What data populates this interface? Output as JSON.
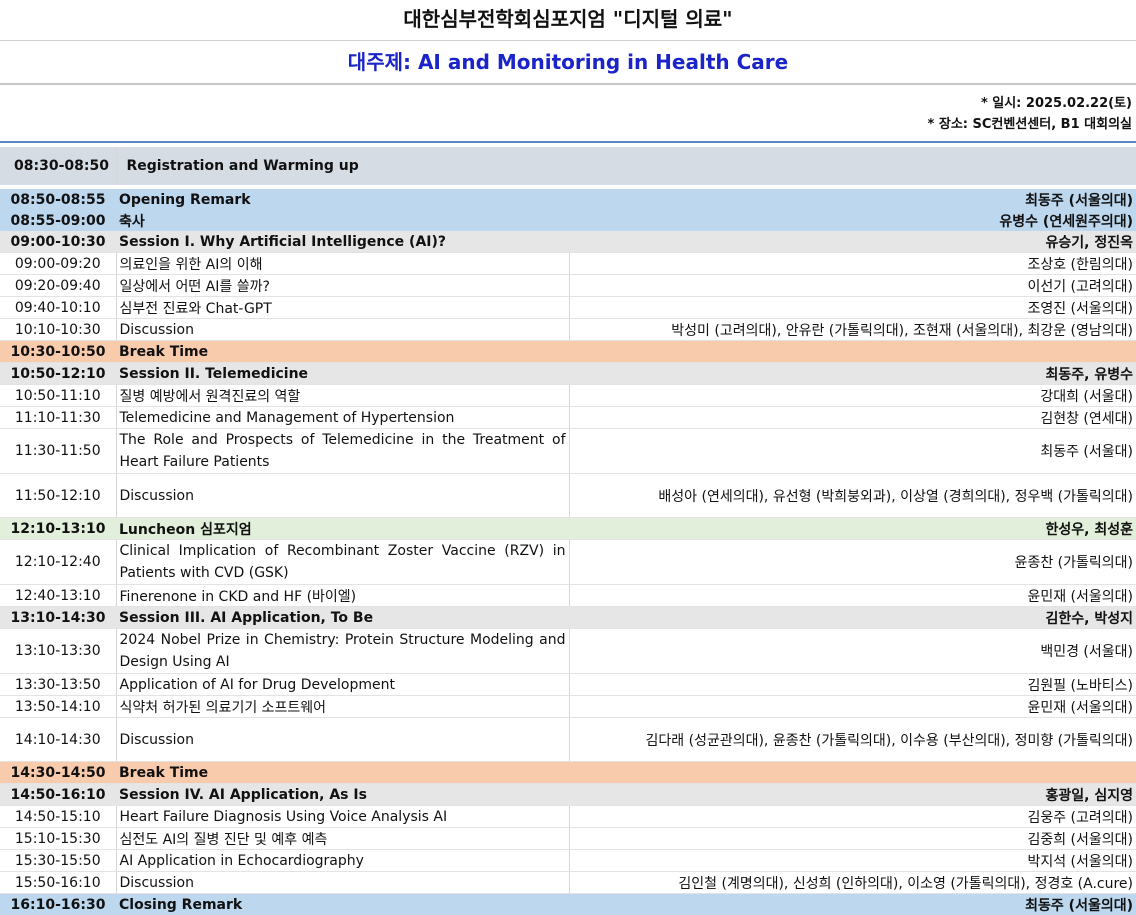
{
  "title": "대한심부전학회심포지엄 \"디지털 의료\"",
  "subtitle": "대주제: AI and Monitoring in Health Care",
  "info": {
    "date": "* 일시: 2025.02.22(토)",
    "venue": "* 장소: SC컨벤션센터, B1 대회의실"
  },
  "registration": {
    "time": "08:30-08:50",
    "label": "Registration and Warming up"
  },
  "rows": [
    {
      "time": "08:50-08:55",
      "topic": "Opening Remark",
      "speaker": "최동주 (서울의대)"
    },
    {
      "time": "08:55-09:00",
      "topic": "축사",
      "speaker": "유병수 (연세원주의대)"
    },
    {
      "time": "09:00-10:30",
      "topic": "Session I. Why Artificial Intelligence (AI)?",
      "speaker": "유승기, 정진옥"
    },
    {
      "time": "09:00-09:20",
      "topic": "의료인을 위한 AI의 이해",
      "speaker": "조상호 (한림의대)"
    },
    {
      "time": "09:20-09:40",
      "topic": "일상에서 어떤 AI를 쓸까?",
      "speaker": "이선기 (고려의대)"
    },
    {
      "time": "09:40-10:10",
      "topic": "심부전 진료와 Chat-GPT",
      "speaker": "조영진 (서울의대)"
    },
    {
      "time": "10:10-10:30",
      "topic": "Discussion",
      "speaker": "박성미 (고려의대), 안유란 (가톨릭의대), 조현재 (서울의대), 최강운 (영남의대)"
    },
    {
      "time": "10:30-10:50",
      "topic": "Break Time",
      "speaker": ""
    },
    {
      "time": "10:50-12:10",
      "topic": "Session II. Telemedicine",
      "speaker": "최동주, 유병수"
    },
    {
      "time": "10:50-11:10",
      "topic": "질병 예방에서 원격진료의 역할",
      "speaker": "강대희 (서울대)"
    },
    {
      "time": "11:10-11:30",
      "topic": "Telemedicine and Management of Hypertension",
      "speaker": "김현창 (연세대)"
    },
    {
      "time": "11:30-11:50",
      "topic": "The Role and Prospects of Telemedicine in the Treatment of Heart Failure Patients",
      "speaker": "최동주 (서울대)"
    },
    {
      "time": "11:50-12:10",
      "topic": "Discussion",
      "speaker": "배성아 (연세의대), 유선형 (박희붕외과), 이상열 (경희의대), 정우백 (가톨릭의대)"
    },
    {
      "time": "12:10-13:10",
      "topic": "Luncheon 심포지엄",
      "speaker": "한성우, 최성훈"
    },
    {
      "time": "12:10-12:40",
      "topic": "Clinical Implication of Recombinant Zoster Vaccine (RZV) in Patients with CVD (GSK)",
      "speaker": "윤종찬 (가톨릭의대)"
    },
    {
      "time": "12:40-13:10",
      "topic": "Finerenone in CKD and HF (바이엘)",
      "speaker": "윤민재 (서울의대)"
    },
    {
      "time": "13:10-14:30",
      "topic": "Session III. AI Application, To Be",
      "speaker": "김한수, 박성지"
    },
    {
      "time": "13:10-13:30",
      "topic": "2024 Nobel Prize in Chemistry: Protein Structure Modeling and Design Using AI",
      "speaker": "백민경 (서울대)"
    },
    {
      "time": "13:30-13:50",
      "topic": "Application of AI for Drug Development",
      "speaker": "김원필 (노바티스)"
    },
    {
      "time": "13:50-14:10",
      "topic": "식약처 허가된 의료기기 소프트웨어",
      "speaker": "윤민재 (서울의대)"
    },
    {
      "time": "14:10-14:30",
      "topic": "Discussion",
      "speaker": "김다래 (성균관의대), 윤종찬 (가톨릭의대), 이수용 (부산의대), 정미향 (가톨릭의대)"
    },
    {
      "time": "14:30-14:50",
      "topic": "Break Time",
      "speaker": ""
    },
    {
      "time": "14:50-16:10",
      "topic": "Session IV. AI Application, As Is",
      "speaker": "홍광일, 심지영"
    },
    {
      "time": "14:50-15:10",
      "topic": "Heart Failure Diagnosis Using Voice Analysis AI",
      "speaker": "김웅주 (고려의대)"
    },
    {
      "time": "15:10-15:30",
      "topic": "심전도 AI의 질병 진단 및 예후 예측",
      "speaker": "김중희 (서울의대)"
    },
    {
      "time": "15:30-15:50",
      "topic": "AI Application in Echocardiography",
      "speaker": "박지석 (서울의대)"
    },
    {
      "time": "15:50-16:10",
      "topic": "Discussion",
      "speaker": "김인철 (계명의대), 신성희 (인하의대), 이소영 (가톨릭의대), 정경호 (A.cure)"
    },
    {
      "time": "16:10-16:30",
      "topic": "Closing Remark",
      "speaker": "최동주 (서울의대)"
    }
  ]
}
